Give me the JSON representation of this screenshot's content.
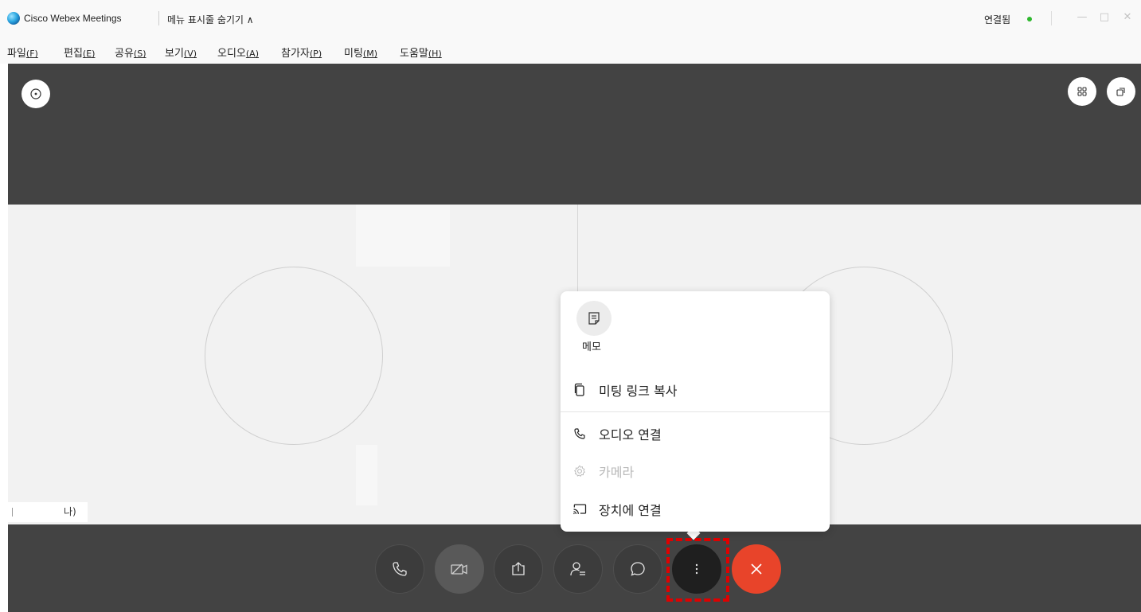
{
  "titlebar": {
    "app_title": "Cisco Webex Meetings",
    "menu_toggle": "메뉴 표시줄 숨기기 ∧",
    "status": "연결됨",
    "status_color": "#2eb82e",
    "minimize": "—",
    "maximize": "□",
    "close": "✕"
  },
  "menubar": {
    "items": [
      {
        "label": "파일",
        "key": "(F)"
      },
      {
        "label": "편집",
        "key": "(E)"
      },
      {
        "label": "공유",
        "key": "(S)"
      },
      {
        "label": "보기",
        "key": "(V)"
      },
      {
        "label": "오디오",
        "key": "(A)"
      },
      {
        "label": "참가자",
        "key": "(P)"
      },
      {
        "label": "미팅",
        "key": "(M)"
      },
      {
        "label": "도움말",
        "key": "(H)"
      }
    ]
  },
  "stage": {
    "name_tag": "나)"
  },
  "popup": {
    "memo_label": "메모",
    "items": [
      {
        "label": "미팅 링크 복사",
        "icon": "copy-icon",
        "enabled": true
      },
      {
        "label": "오디오 연결",
        "icon": "phone-icon",
        "enabled": true
      },
      {
        "label": "카메라",
        "icon": "gear-icon",
        "enabled": false
      },
      {
        "label": "장치에 연결",
        "icon": "cast-icon",
        "enabled": true
      }
    ]
  },
  "controls": {
    "buttons": [
      "phone-icon",
      "video-off-icon",
      "share-icon",
      "participants-icon",
      "chat-icon",
      "more-icon",
      "end-call-icon"
    ],
    "end_color": "#e8442a",
    "highlight_color": "#e00000"
  }
}
